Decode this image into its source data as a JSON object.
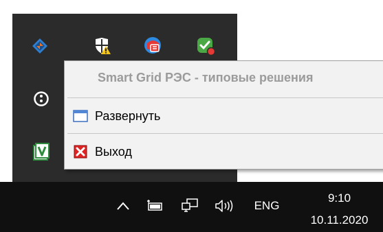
{
  "flyout": {
    "icons": [
      "app-diamond-icon",
      "windows-security-warning-icon",
      "red-chat-icon",
      "green-shield-status-icon",
      "alert-circle-icon",
      "v-app-icon"
    ]
  },
  "menu": {
    "title": "Smart Grid РЭС - типовые решения",
    "items": [
      {
        "label": "Развернуть",
        "icon": "restore-window-icon"
      },
      {
        "label": "Выход",
        "icon": "exit-icon"
      }
    ]
  },
  "taskbar": {
    "language": "ENG",
    "time": "9:10",
    "date": "10.11.2020",
    "icons": [
      "chevron-up-icon",
      "battery-icon",
      "network-icon",
      "volume-icon"
    ]
  },
  "colors": {
    "flyout_bg": "#2b2b2b",
    "taskbar_bg": "#101010",
    "menu_bg": "#f2f2f2",
    "menu_title": "#9b9b9b"
  }
}
